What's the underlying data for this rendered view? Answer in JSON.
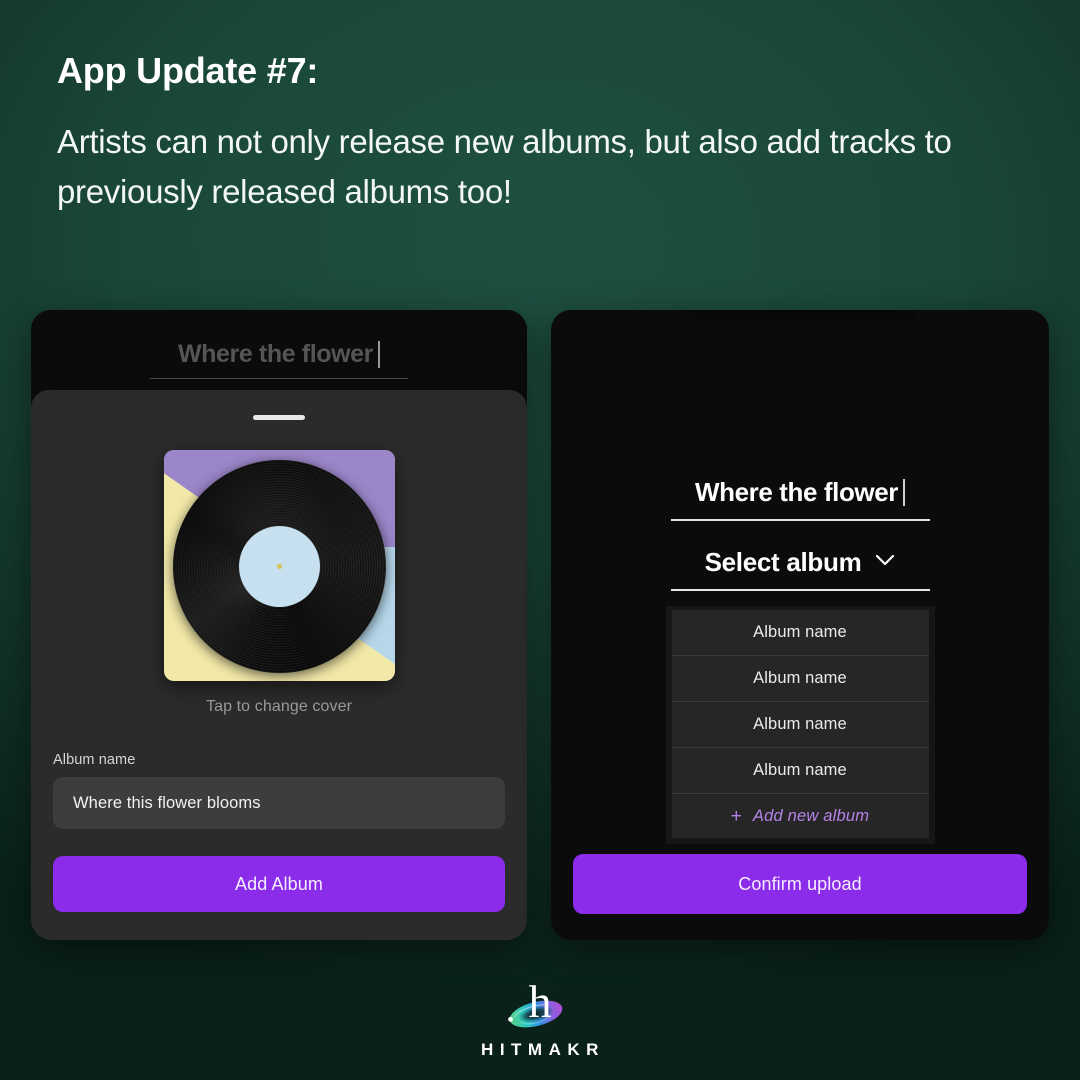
{
  "headline": {
    "title": "App Update #7:",
    "body": "Artists can not only release new albums, but also add tracks to previously released albums too!"
  },
  "colors": {
    "background_green_light": "#1e5041",
    "background_green_dark": "#092119",
    "accent_purple": "#8b2ceb",
    "accent_purple_text": "#b583e8",
    "card_black": "#0b0b0b",
    "sheet_grey": "#2b2b2b",
    "input_grey": "#3d3d3d",
    "cover_yellow": "#f2e8a8",
    "cover_purple": "#9b86c9",
    "cover_blue": "#b6d7ea",
    "vinyl_label_blue": "#c6e0ef",
    "vinyl_hole_yellow": "#d4c158"
  },
  "left_screen": {
    "header_title": "Where the flower",
    "drag_handle": "sheet-drag-handle",
    "cover_caption": "Tap to change cover",
    "album_name_label": "Album name",
    "album_name_value": "Where this flower blooms",
    "primary_button": "Add Album"
  },
  "right_screen": {
    "track_title": "Where the flower",
    "select_label": "Select album",
    "chevron": "chevron-down-icon",
    "album_options": [
      "Album name",
      "Album name",
      "Album name",
      "Album name"
    ],
    "add_new_album": {
      "plus": "+",
      "label": "Add new album"
    },
    "primary_button": "Confirm upload"
  },
  "footer": {
    "logo_letter": "h",
    "brand": "HITMAKR"
  }
}
